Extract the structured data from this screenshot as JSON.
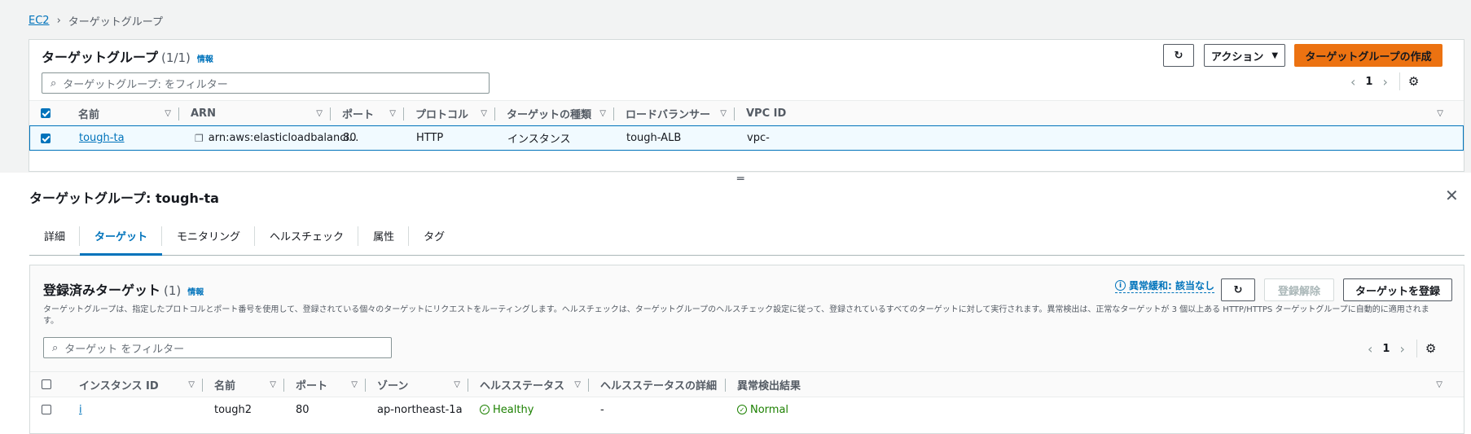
{
  "breadcrumb": {
    "root": "EC2",
    "current": "ターゲットグループ"
  },
  "top_panel": {
    "title": "ターゲットグループ",
    "count": "(1/1)",
    "info": "情報",
    "actions_label": "アクション",
    "create_label": "ターゲットグループの作成",
    "filter_placeholder": "ターゲットグループ: をフィルター",
    "page": "1",
    "columns": [
      "名前",
      "ARN",
      "ポート",
      "プロトコル",
      "ターゲットの種類",
      "ロードバランサー",
      "VPC ID"
    ],
    "row": {
      "name": "tough-ta",
      "arn": "arn:aws:elasticloadbalanci...",
      "port": "80",
      "protocol": "HTTP",
      "target_type": "インスタンス",
      "load_balancer": "tough-ALB",
      "vpc_id": "vpc-"
    }
  },
  "detail": {
    "title": "ターゲットグループ: tough-ta",
    "tabs": [
      "詳細",
      "ターゲット",
      "モニタリング",
      "ヘルスチェック",
      "属性",
      "タグ"
    ],
    "active_tab": "ターゲット"
  },
  "targets_panel": {
    "title": "登録済みターゲット",
    "count": "(1)",
    "info": "情報",
    "anomaly_label": "異常緩和: 該当なし",
    "deregister_label": "登録解除",
    "register_label": "ターゲットを登録",
    "description": "ターゲットグループは、指定したプロトコルとポート番号を使用して、登録されている個々のターゲットにリクエストをルーティングします。ヘルスチェックは、ターゲットグループのヘルスチェック設定に従って、登録されているすべてのターゲットに対して実行されます。異常検出は、正常なターゲットが 3 個以上ある HTTP/HTTPS ターゲットグループに自動的に適用されます。",
    "filter_placeholder": "ターゲット をフィルター",
    "page": "1",
    "columns": [
      "インスタンス ID",
      "名前",
      "ポート",
      "ゾーン",
      "ヘルスステータス",
      "ヘルスステータスの詳細",
      "異常検出結果"
    ],
    "row": {
      "instance_id": "i",
      "name": "tough2",
      "port": "80",
      "zone": "ap-northeast-1a",
      "health": "Healthy",
      "health_detail": "-",
      "anomaly": "Normal"
    }
  },
  "colors": {
    "accent": "#0073bb",
    "primary": "#ec7211",
    "success": "#1d8102"
  }
}
